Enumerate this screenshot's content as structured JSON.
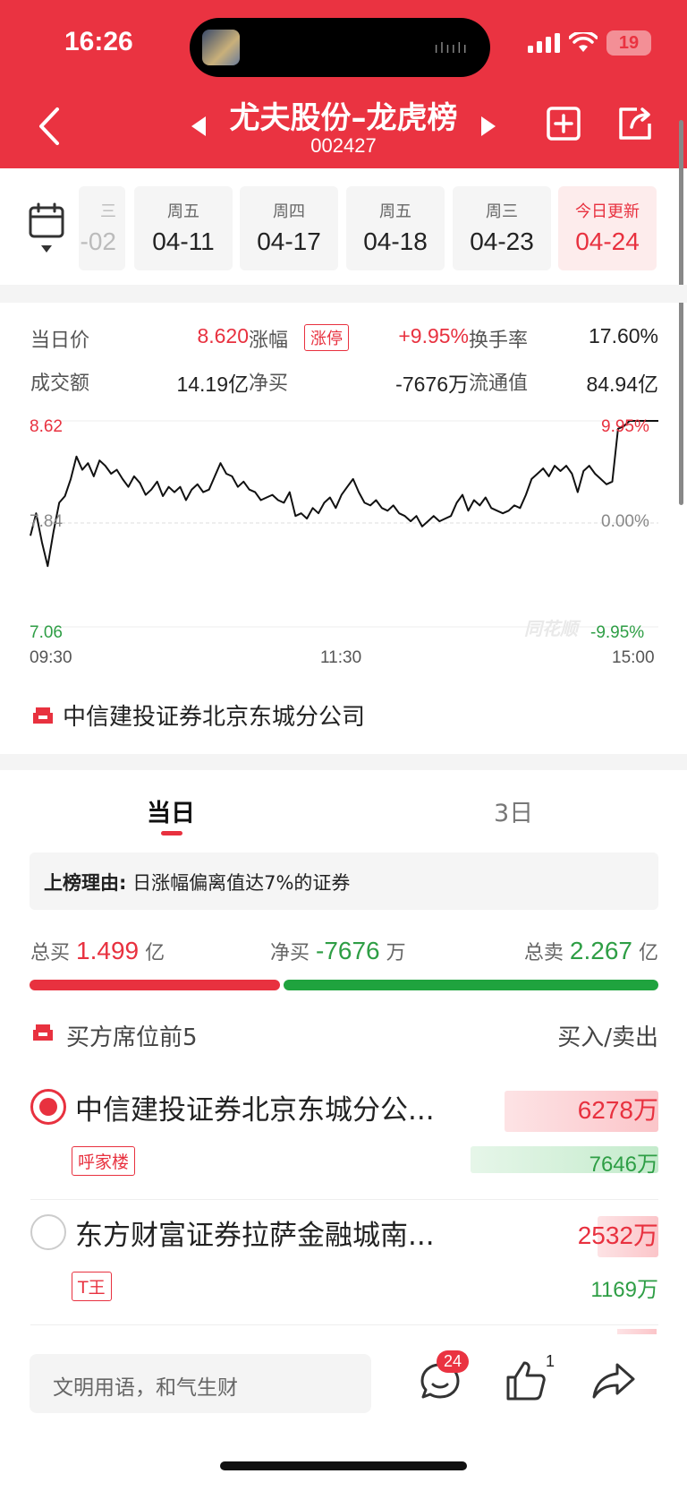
{
  "status": {
    "time": "16:26",
    "battery": "19"
  },
  "nav": {
    "title": "尤夫股份–龙虎榜",
    "code": "002427"
  },
  "dates": [
    {
      "weekday": "三",
      "date": "-02"
    },
    {
      "weekday": "周五",
      "date": "04-11"
    },
    {
      "weekday": "周四",
      "date": "04-17"
    },
    {
      "weekday": "周五",
      "date": "04-18"
    },
    {
      "weekday": "周三",
      "date": "04-23"
    },
    {
      "weekday": "今日更新",
      "date": "04-24"
    }
  ],
  "stats": {
    "price_label": "当日价",
    "price_value": "8.620",
    "change_label": "涨幅",
    "limit_badge": "涨停",
    "change_value": "+9.95%",
    "turnover_label": "换手率",
    "turnover_value": "17.60%",
    "amount_label": "成交额",
    "amount_value": "14.19亿",
    "net_label": "净买",
    "net_value": "-7676万",
    "float_label": "流通值",
    "float_value": "84.94亿"
  },
  "chart_data": {
    "type": "line",
    "y_left_ticks": [
      "8.62",
      "7.84",
      "7.06"
    ],
    "y_right_ticks": [
      "9.95%",
      "0.00%",
      "-9.95%"
    ],
    "x_ticks": [
      "09:30",
      "11:30",
      "15:00"
    ],
    "ylim": [
      7.06,
      8.62
    ],
    "watermark": "同花顺",
    "series": [
      {
        "values": [
          7.75,
          7.92,
          7.7,
          7.52,
          7.78,
          8.0,
          8.05,
          8.18,
          8.35,
          8.25,
          8.3,
          8.2,
          8.32,
          8.28,
          8.22,
          8.25,
          8.18,
          8.12,
          8.2,
          8.15,
          8.06,
          8.1,
          8.16,
          8.05,
          8.12,
          8.08,
          8.12,
          8.02,
          8.1,
          8.14,
          8.08,
          8.1,
          8.2,
          8.3,
          8.22,
          8.2,
          8.12,
          8.16,
          8.1,
          8.08,
          8.02,
          8.04,
          8.06,
          8.02,
          8.0,
          8.08,
          7.9,
          7.92,
          7.88,
          7.96,
          7.92,
          8.0,
          8.04,
          7.96,
          8.06,
          8.12,
          8.18,
          8.08,
          8.0,
          7.98,
          8.02,
          7.96,
          7.94,
          7.98,
          7.92,
          7.9,
          7.86,
          7.9,
          7.82,
          7.86,
          7.9,
          7.86,
          7.88,
          7.9,
          8.0,
          8.06,
          7.94,
          8.02,
          7.98,
          8.04,
          7.96,
          7.94,
          7.92,
          7.94,
          7.98,
          7.96,
          8.06,
          8.18,
          8.22,
          8.26,
          8.2,
          8.28,
          8.24,
          8.28,
          8.22,
          8.08,
          8.24,
          8.28,
          8.22,
          8.18,
          8.14,
          8.16,
          8.56,
          8.58,
          8.62,
          8.62,
          8.62,
          8.62,
          8.62,
          8.62
        ]
      }
    ]
  },
  "top_broker": "中信建投证券北京东城分公司",
  "tabs": [
    {
      "label": "当日"
    },
    {
      "label": "3日"
    }
  ],
  "reason": {
    "label": "上榜理由:",
    "text": "日涨幅偏离值达7%的证券"
  },
  "totals": {
    "buy_label": "总买",
    "buy_value": "1.499",
    "buy_unit": "亿",
    "net_label": "净买",
    "net_value": "-7676",
    "net_unit": "万",
    "sell_label": "总卖",
    "sell_value": "2.267",
    "sell_unit": "亿",
    "buy_fraction": 0.398
  },
  "seats": {
    "title": "买方席位前5",
    "column": "买入/卖出",
    "rows": [
      {
        "name": "中信建投证券北京东城分公...",
        "tag": "呼家楼",
        "buy": "6278万",
        "sell": "7646万",
        "selected": true
      },
      {
        "name": "东方财富证券拉萨金融城南...",
        "tag": "T王",
        "buy": "2532万",
        "sell": "1169万",
        "selected": false
      }
    ]
  },
  "bottom": {
    "placeholder": "文明用语，和气生财",
    "comment_count": "24",
    "like_count": "1"
  },
  "colors": {
    "brand_red": "#ea3341",
    "up_red": "#e8313f",
    "down_green": "#2e9e45"
  }
}
